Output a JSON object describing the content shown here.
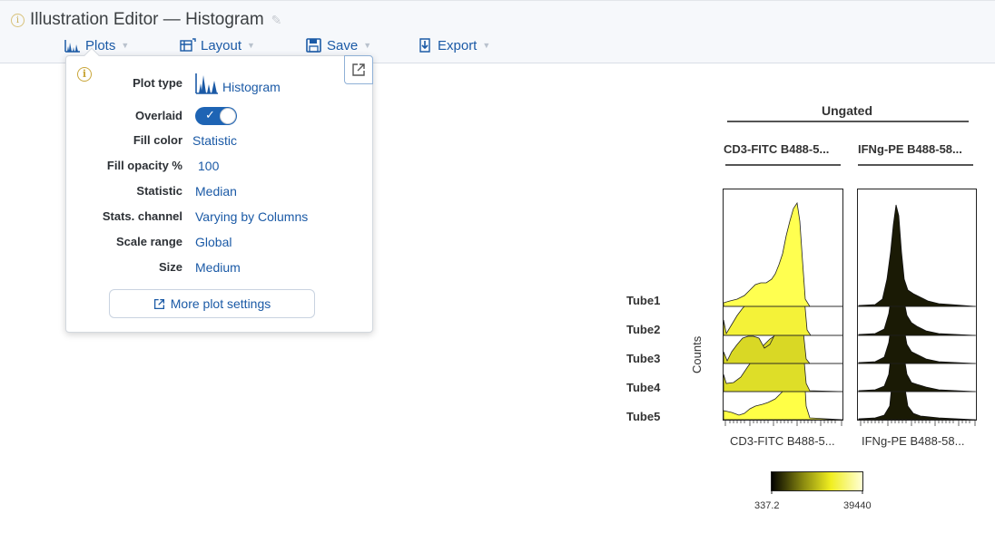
{
  "header": {
    "title": "Illustration Editor — Histogram",
    "menu": [
      {
        "label": "Plots",
        "icon": "histogram-icon"
      },
      {
        "label": "Layout",
        "icon": "layout-icon"
      },
      {
        "label": "Save",
        "icon": "save-icon"
      },
      {
        "label": "Export",
        "icon": "export-icon"
      }
    ]
  },
  "popover": {
    "rows": [
      {
        "label": "Plot type",
        "value": "Histogram"
      },
      {
        "label": "Overlaid",
        "value": "on"
      },
      {
        "label": "Fill color",
        "value": "Statistic"
      },
      {
        "label": "Fill opacity %",
        "value": "100"
      },
      {
        "label": "Statistic",
        "value": "Median"
      },
      {
        "label": "Stats. channel",
        "value": "Varying by Columns"
      },
      {
        "label": "Scale range",
        "value": "Global"
      },
      {
        "label": "Size",
        "value": "Medium"
      }
    ],
    "more_button": "More plot settings"
  },
  "plot": {
    "group_header": "Ungated",
    "columns": [
      "CD3-FITC B488-5...",
      "IFNg-PE B488-58..."
    ],
    "x_labels": [
      "CD3-FITC B488-5...",
      "IFNg-PE B488-58..."
    ],
    "rows": [
      "Tube1",
      "Tube2",
      "Tube3",
      "Tube4",
      "Tube5"
    ],
    "y_label": "Counts",
    "colorbar": {
      "min": "337.2",
      "max": "39440"
    }
  },
  "colors": {
    "accent": "#1b5aa6",
    "toggle": "#1e64b4",
    "fill_low": "#1a1a00",
    "fill_high": "#ffff40"
  }
}
